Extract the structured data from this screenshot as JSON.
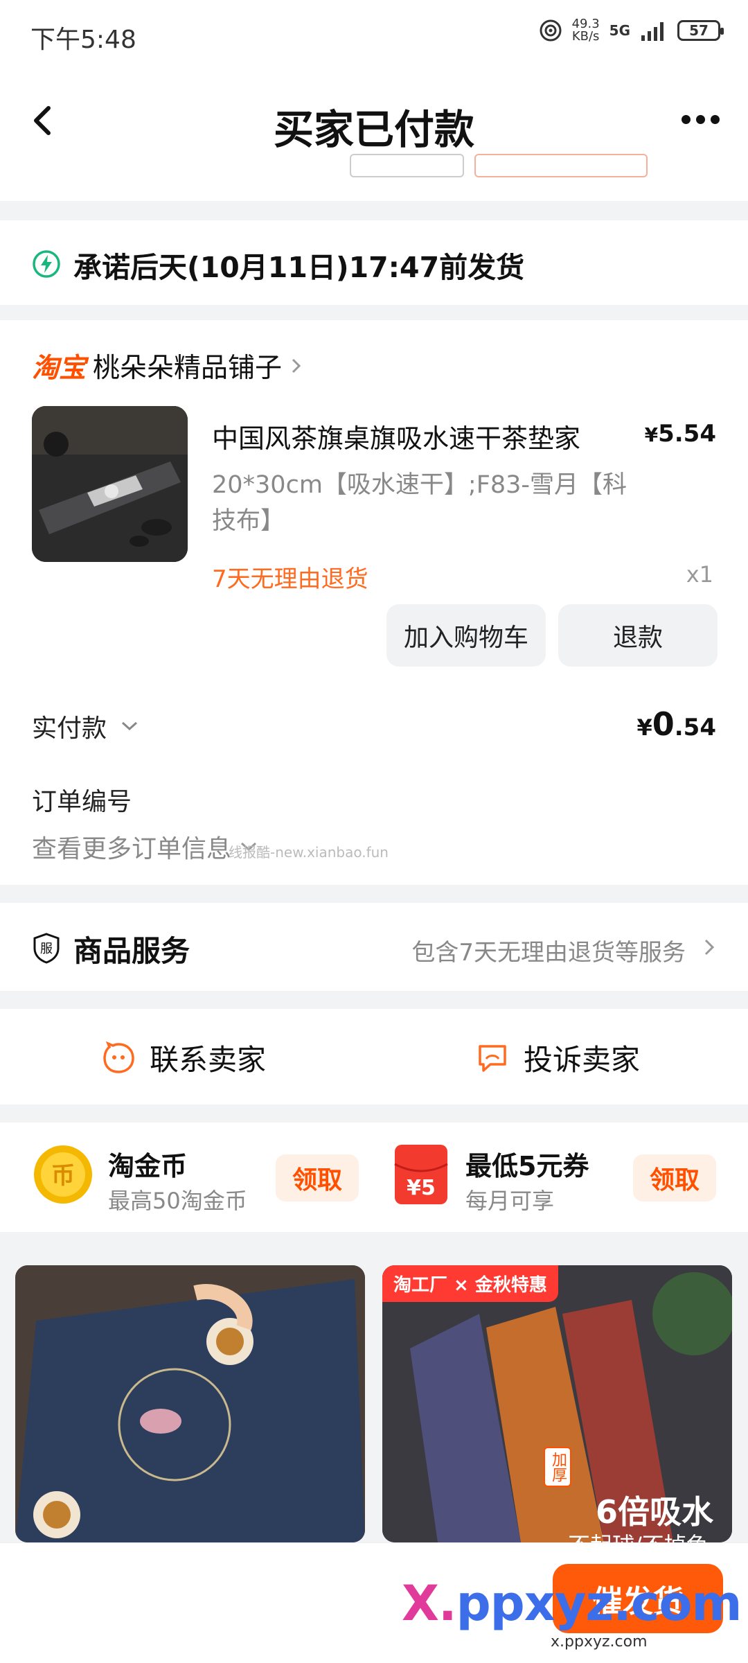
{
  "status_bar": {
    "time": "下午5:48",
    "net_speed_value": "49.3",
    "net_speed_unit": "KB/s",
    "network": "5G",
    "battery": "57"
  },
  "nav": {
    "title": "买家已付款"
  },
  "delivery": {
    "promise": "承诺后天(10月11日)17:47前发货"
  },
  "shop": {
    "logo": "淘宝",
    "name": "桃朵朵精品铺子"
  },
  "product": {
    "title": "中国风茶旗桌旗吸水速干茶垫家",
    "price_symbol": "¥",
    "price": "5.54",
    "spec": "20*30cm【吸水速干】;F83-雪月【科技布】",
    "return_policy": "7天无理由退货",
    "quantity": "x1"
  },
  "actions": {
    "add_to_cart": "加入购物车",
    "refund": "退款"
  },
  "payment": {
    "label": "实付款",
    "symbol": "¥",
    "amount_int": "0",
    "amount_dec": ".54"
  },
  "order": {
    "number_label": "订单编号",
    "more_info": "查看更多订单信息"
  },
  "watermark": "线报酷-new.xianbao.fun",
  "service": {
    "title": "商品服务",
    "desc": "包含7天无理由退货等服务"
  },
  "contact": {
    "contact_seller": "联系卖家",
    "complain_seller": "投诉卖家"
  },
  "coupons": {
    "coin_title": "淘金币",
    "coin_sub": "最高50淘金币",
    "coin_claim": "领取",
    "coupon_title": "最低5元券",
    "coupon_sub": "每月可享",
    "coupon_claim": "领取",
    "coupon_badge": "¥5"
  },
  "recommend": {
    "right_tag": "淘工厂 × 金秋特惠",
    "right_badge": "加厚",
    "right_caption": "6倍吸水",
    "right_caption2": "不起球/不掉色"
  },
  "bottom": {
    "remind_button": "催发货",
    "brand_mark": "ppxyz.com",
    "brand_url": "x.ppxyz.com"
  },
  "colors": {
    "accent": "#ff5000",
    "delivery_green": "#19b77d",
    "background": "#f2f3f5"
  }
}
